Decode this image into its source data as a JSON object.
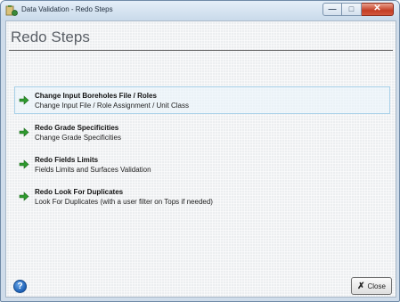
{
  "window": {
    "title": "Data Validation - Redo Steps",
    "controls": {
      "minimize": "—",
      "maximize": "□",
      "close": "✕"
    }
  },
  "header": {
    "title": "Redo Steps"
  },
  "steps": [
    {
      "title": "Change Input Boreholes File / Roles",
      "subtitle": "Change Input File / Role Assignment / Unit Class",
      "selected": true
    },
    {
      "title": "Redo Grade Specificities",
      "subtitle": "Change Grade Specificities",
      "selected": false
    },
    {
      "title": "Redo Fields Limits",
      "subtitle": "Fields Limits and Surfaces Validation",
      "selected": false
    },
    {
      "title": "Redo Look For Duplicates",
      "subtitle": "Look For Duplicates (with a user filter on Tops if needed)",
      "selected": false
    }
  ],
  "footer": {
    "help_glyph": "?",
    "close_label": "Close",
    "close_glyph": "✗"
  },
  "colors": {
    "accent_arrow": "#2e9a2e",
    "selected_border": "#a8d0e8",
    "close_red": "#c43d24"
  },
  "icons": {
    "step_arrow": "arrow-right-icon",
    "app": "app-icon",
    "help": "help-icon",
    "close": "close-x-icon"
  }
}
